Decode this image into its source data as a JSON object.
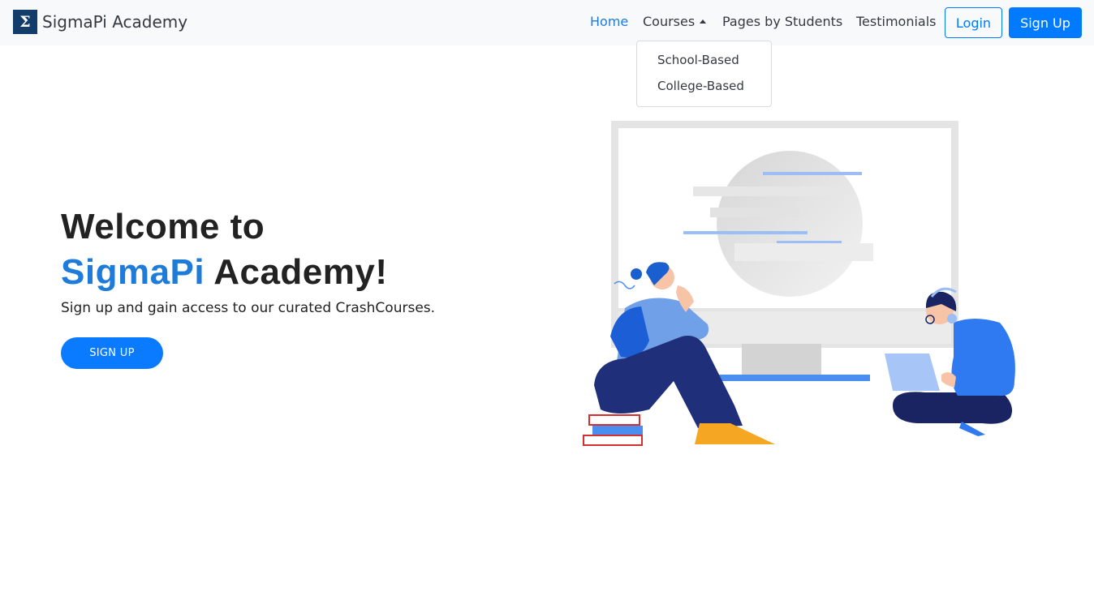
{
  "brand": {
    "logo_glyph": "Σ",
    "name": "SigmaPi Academy"
  },
  "nav": {
    "home": "Home",
    "courses": "Courses",
    "pages": "Pages by Students",
    "testimonials": "Testimonials",
    "login": "Login",
    "signup": "Sign Up"
  },
  "courses_dropdown": {
    "items": [
      "School-Based",
      "College-Based"
    ]
  },
  "hero": {
    "title_line1": "Welcome to",
    "title_accent": "SigmaPi",
    "title_rest": " Academy!",
    "subtitle": "Sign up and gain access to our curated CrashCourses.",
    "cta": "SIGN UP"
  },
  "colors": {
    "primary": "#007bff",
    "accent": "#1e7bd9",
    "navbar_bg": "#f8f9fa"
  }
}
